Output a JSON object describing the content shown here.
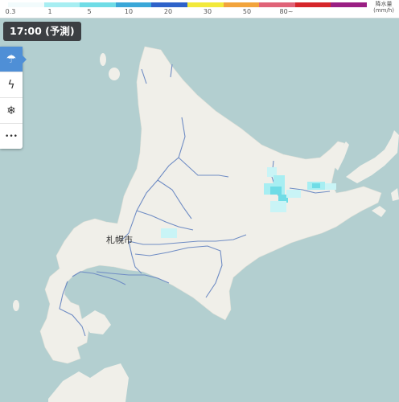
{
  "legend": {
    "unit": "降水量\n(mm/h)",
    "ticks": [
      "0.3",
      "1",
      "5",
      "10",
      "20",
      "30",
      "50",
      "80~"
    ],
    "colors": [
      "#f2fbfc",
      "#a7eef2",
      "#6fdce6",
      "#3aa7d8",
      "#2e62c9",
      "#f2e93b",
      "#f2a43c",
      "#e06378",
      "#d6262b",
      "#9a1f83"
    ]
  },
  "time_chip": "17:00 (予測)",
  "menu": [
    {
      "icon": "rain-cloud-icon",
      "glyph": "☂",
      "active": true
    },
    {
      "icon": "lightning-icon",
      "glyph": "ϟ",
      "active": false
    },
    {
      "icon": "snowflake-icon",
      "glyph": "❄",
      "active": false
    },
    {
      "icon": "more-icon",
      "glyph": "•••",
      "active": false
    }
  ],
  "map": {
    "sea_color": "#b3cfd0",
    "land_color": "#f0efe9",
    "road_color": "#6f8cc4",
    "city_label": "札幌市"
  }
}
